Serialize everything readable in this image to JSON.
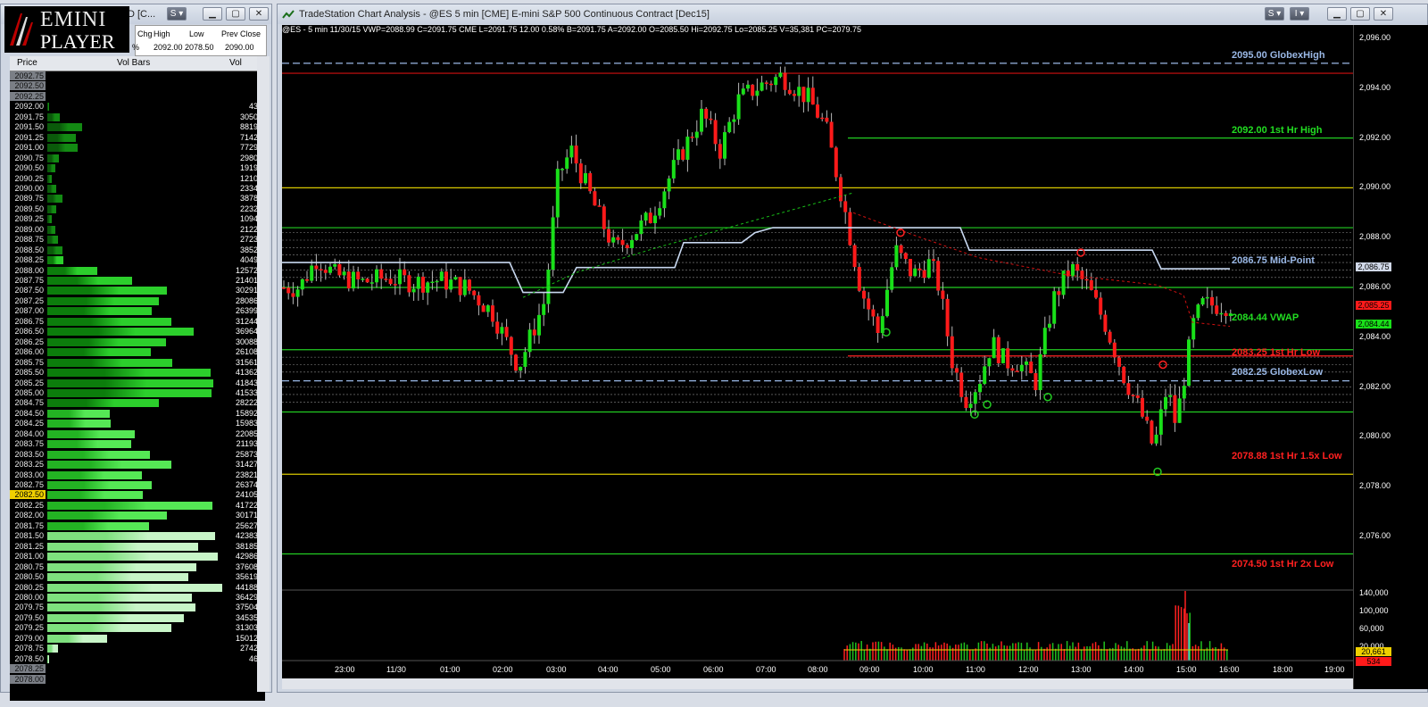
{
  "logo": {
    "line1": "EMINI",
    "line2": "PLAYER"
  },
  "left_window": {
    "title": "D [C...",
    "quote_headers": [
      "Chg",
      "High",
      "Low",
      "Prev Close"
    ],
    "quote_values": [
      "%",
      "2092.00",
      "2078.50",
      "2090.00"
    ]
  },
  "ladder": {
    "headers": [
      "Price",
      "Vol Bars",
      "Vol"
    ],
    "rows": [
      {
        "p": "2092.75",
        "v": ""
      },
      {
        "p": "2092.50",
        "v": ""
      },
      {
        "p": "2092.25",
        "v": ""
      },
      {
        "p": "2092.00",
        "v": "43"
      },
      {
        "p": "2091.75",
        "v": "3050"
      },
      {
        "p": "2091.50",
        "v": "8819"
      },
      {
        "p": "2091.25",
        "v": "7142"
      },
      {
        "p": "2091.00",
        "v": "7729"
      },
      {
        "p": "2090.75",
        "v": "2980"
      },
      {
        "p": "2090.50",
        "v": "1919"
      },
      {
        "p": "2090.25",
        "v": "1210"
      },
      {
        "p": "2090.00",
        "v": "2334"
      },
      {
        "p": "2089.75",
        "v": "3878"
      },
      {
        "p": "2089.50",
        "v": "2232"
      },
      {
        "p": "2089.25",
        "v": "1094"
      },
      {
        "p": "2089.00",
        "v": "2122"
      },
      {
        "p": "2088.75",
        "v": "2723"
      },
      {
        "p": "2088.50",
        "v": "3852"
      },
      {
        "p": "2088.25",
        "v": "4049"
      },
      {
        "p": "2088.00",
        "v": "12572"
      },
      {
        "p": "2087.75",
        "v": "21401"
      },
      {
        "p": "2087.50",
        "v": "30291"
      },
      {
        "p": "2087.25",
        "v": "28086"
      },
      {
        "p": "2087.00",
        "v": "26399"
      },
      {
        "p": "2086.75",
        "v": "31244"
      },
      {
        "p": "2086.50",
        "v": "36964"
      },
      {
        "p": "2086.25",
        "v": "30088"
      },
      {
        "p": "2086.00",
        "v": "26108"
      },
      {
        "p": "2085.75",
        "v": "31561"
      },
      {
        "p": "2085.50",
        "v": "41362"
      },
      {
        "p": "2085.25",
        "v": "41843"
      },
      {
        "p": "2085.00",
        "v": "41533"
      },
      {
        "p": "2084.75",
        "v": "28222"
      },
      {
        "p": "2084.50",
        "v": "15892"
      },
      {
        "p": "2084.25",
        "v": "15983"
      },
      {
        "p": "2084.00",
        "v": "22085"
      },
      {
        "p": "2083.75",
        "v": "21193"
      },
      {
        "p": "2083.50",
        "v": "25873"
      },
      {
        "p": "2083.25",
        "v": "31427"
      },
      {
        "p": "2083.00",
        "v": "23821"
      },
      {
        "p": "2082.75",
        "v": "26374"
      },
      {
        "p": "2082.50",
        "v": "24105"
      },
      {
        "p": "2082.25",
        "v": "41722"
      },
      {
        "p": "2082.00",
        "v": "30171"
      },
      {
        "p": "2081.75",
        "v": "25627"
      },
      {
        "p": "2081.50",
        "v": "42383"
      },
      {
        "p": "2081.25",
        "v": "38185"
      },
      {
        "p": "2081.00",
        "v": "42986"
      },
      {
        "p": "2080.75",
        "v": "37608"
      },
      {
        "p": "2080.50",
        "v": "35619"
      },
      {
        "p": "2080.25",
        "v": "44188"
      },
      {
        "p": "2080.00",
        "v": "36429"
      },
      {
        "p": "2079.75",
        "v": "37504"
      },
      {
        "p": "2079.50",
        "v": "34535"
      },
      {
        "p": "2079.25",
        "v": "31303"
      },
      {
        "p": "2079.00",
        "v": "15012"
      },
      {
        "p": "2078.75",
        "v": "2742"
      },
      {
        "p": "2078.50",
        "v": "46"
      },
      {
        "p": "2078.25",
        "v": ""
      },
      {
        "p": "2078.00",
        "v": ""
      }
    ],
    "highlight_price": "2082.50"
  },
  "chart_window": {
    "title": "TradeStation Chart Analysis - @ES 5 min [CME] E-mini S&P 500 Continuous Contract [Dec15]",
    "info": "@ES - 5 min   11/30/15   VWP=2088.99   C=2091.75   CME   L=2091.75   12.00   0.58%   B=2091.75   A=2092.00   O=2085.50   Hi=2092.75   Lo=2085.25   V=35,381   PC=2079.75",
    "price_ticks": [
      "2,096.00",
      "2,094.00",
      "2,092.00",
      "2,090.00",
      "2,088.00",
      "2,086.00",
      "2,084.00",
      "2,082.00",
      "2,080.00",
      "2,078.00",
      "2,076.00"
    ],
    "volume_ticks": [
      "140,000",
      "100,000",
      "60,000",
      "20,000"
    ],
    "time_ticks": [
      "23:00",
      "11/30",
      "01:00",
      "02:00",
      "03:00",
      "04:00",
      "05:00",
      "06:00",
      "07:00",
      "08:00",
      "09:00",
      "10:00",
      "11:00",
      "12:00",
      "13:00",
      "14:00",
      "15:00",
      "16:00",
      "18:00",
      "19:00"
    ],
    "price_tags": [
      "2,086.75",
      "2,085.25",
      "2,084.44"
    ],
    "volume_tags": [
      "20,661",
      "534"
    ],
    "levels": [
      {
        "text": "2095.00 GlobexHigh",
        "color": "#9ab8e6"
      },
      {
        "text": "2092.00 1st Hr  High",
        "color": "#22dd22"
      },
      {
        "text": "2086.75 Mid-Point",
        "color": "#9ab8e6"
      },
      {
        "text": "2084.44 VWAP",
        "color": "#22dd22"
      },
      {
        "text": "2083.25 1st Hr  Low",
        "color": "#ff2020"
      },
      {
        "text": "2082.25 GlobexLow",
        "color": "#9ab8e6"
      },
      {
        "text": "2078.88 1st Hr  1.5x Low",
        "color": "#ff2020"
      },
      {
        "text": "2074.50 1st Hr  2x Low",
        "color": "#ff2020"
      }
    ]
  },
  "chart_data": {
    "type": "candlestick",
    "interval": "5 min",
    "y_range": [
      2074,
      2096.5
    ],
    "close_path": [
      {
        "t": "22:20",
        "p": 2086.0
      },
      {
        "t": "22:40",
        "p": 2087.2
      },
      {
        "t": "23:00",
        "p": 2086.5
      },
      {
        "t": "23:30",
        "p": 2086.2
      },
      {
        "t": "00:00",
        "p": 2086.4
      },
      {
        "t": "00:30",
        "p": 2086.2
      },
      {
        "t": "01:00",
        "p": 2086.3
      },
      {
        "t": "01:30",
        "p": 2086.0
      },
      {
        "t": "02:00",
        "p": 2085.0
      },
      {
        "t": "02:30",
        "p": 2082.8
      },
      {
        "t": "03:00",
        "p": 2085.5
      },
      {
        "t": "03:15",
        "p": 2090.5
      },
      {
        "t": "03:30",
        "p": 2091.5
      },
      {
        "t": "04:00",
        "p": 2089.0
      },
      {
        "t": "04:20",
        "p": 2087.5
      },
      {
        "t": "05:00",
        "p": 2088.8
      },
      {
        "t": "05:30",
        "p": 2091.0
      },
      {
        "t": "06:00",
        "p": 2093.0
      },
      {
        "t": "06:20",
        "p": 2091.5
      },
      {
        "t": "06:40",
        "p": 2093.5
      },
      {
        "t": "07:00",
        "p": 2094.0
      },
      {
        "t": "07:30",
        "p": 2094.5
      },
      {
        "t": "08:00",
        "p": 2093.6
      },
      {
        "t": "08:20",
        "p": 2092.5
      },
      {
        "t": "08:40",
        "p": 2089.5
      },
      {
        "t": "09:00",
        "p": 2086.0
      },
      {
        "t": "09:20",
        "p": 2084.2
      },
      {
        "t": "09:40",
        "p": 2087.5
      },
      {
        "t": "10:00",
        "p": 2086.5
      },
      {
        "t": "10:20",
        "p": 2087.0
      },
      {
        "t": "10:30",
        "p": 2086.0
      },
      {
        "t": "10:45",
        "p": 2083.0
      },
      {
        "t": "11:00",
        "p": 2081.5
      },
      {
        "t": "11:15",
        "p": 2082.2
      },
      {
        "t": "11:30",
        "p": 2083.8
      },
      {
        "t": "11:45",
        "p": 2083.0
      },
      {
        "t": "12:00",
        "p": 2083.0
      },
      {
        "t": "12:20",
        "p": 2082.2
      },
      {
        "t": "12:40",
        "p": 2085.5
      },
      {
        "t": "13:00",
        "p": 2086.8
      },
      {
        "t": "13:20",
        "p": 2086.0
      },
      {
        "t": "13:40",
        "p": 2084.5
      },
      {
        "t": "14:00",
        "p": 2082.5
      },
      {
        "t": "14:20",
        "p": 2081.0
      },
      {
        "t": "14:35",
        "p": 2079.5
      },
      {
        "t": "14:50",
        "p": 2082.0
      },
      {
        "t": "15:00",
        "p": 2080.5
      },
      {
        "t": "15:10",
        "p": 2082.5
      },
      {
        "t": "15:20",
        "p": 2084.5
      },
      {
        "t": "15:30",
        "p": 2085.3
      }
    ]
  }
}
